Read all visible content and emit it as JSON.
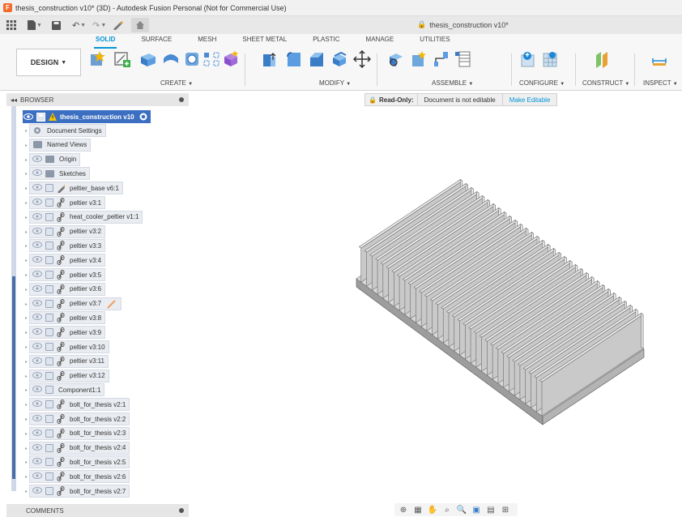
{
  "window": {
    "title": "thesis_construction v10* (3D) - Autodesk Fusion Personal (Not for Commercial Use)",
    "app_icon": "F"
  },
  "quick_access": {
    "document_title": "thesis_construction v10*"
  },
  "ribbon": {
    "workspace_label": "DESIGN",
    "tabs": [
      "SOLID",
      "SURFACE",
      "MESH",
      "SHEET METAL",
      "PLASTIC",
      "MANAGE",
      "UTILITIES"
    ],
    "active_tab": "SOLID",
    "groups": {
      "create": "CREATE",
      "modify": "MODIFY",
      "assemble": "ASSEMBLE",
      "configure": "CONFIGURE",
      "construct": "CONSTRUCT",
      "inspect": "INSPECT"
    }
  },
  "browser": {
    "header": "BROWSER",
    "root_label": "thesis_construction v10",
    "items": [
      {
        "label": "Document Settings",
        "kind": "settings"
      },
      {
        "label": "Named Views",
        "kind": "folder"
      },
      {
        "label": "Origin",
        "kind": "folder"
      },
      {
        "label": "Sketches",
        "kind": "folder"
      },
      {
        "label": "peltier_base v6:1",
        "kind": "component"
      },
      {
        "label": "peltier v3:1",
        "kind": "link"
      },
      {
        "label": "heat_cooler_peltier v1:1",
        "kind": "link"
      },
      {
        "label": "peltier v3:2",
        "kind": "link"
      },
      {
        "label": "peltier v3:3",
        "kind": "link"
      },
      {
        "label": "peltier v3:4",
        "kind": "link"
      },
      {
        "label": "peltier v3:5",
        "kind": "link"
      },
      {
        "label": "peltier v3:6",
        "kind": "link"
      },
      {
        "label": "peltier v3:7",
        "kind": "link"
      },
      {
        "label": "peltier v3:8",
        "kind": "link"
      },
      {
        "label": "peltier v3:9",
        "kind": "link"
      },
      {
        "label": "peltier v3:10",
        "kind": "link"
      },
      {
        "label": "peltier v3:11",
        "kind": "link"
      },
      {
        "label": "peltier v3:12",
        "kind": "link"
      },
      {
        "label": "Component1:1",
        "kind": "plain"
      },
      {
        "label": "bolt_for_thesis v2:1",
        "kind": "link"
      },
      {
        "label": "bolt_for_thesis v2:2",
        "kind": "link"
      },
      {
        "label": "bolt_for_thesis v2:3",
        "kind": "link"
      },
      {
        "label": "bolt_for_thesis v2:4",
        "kind": "link"
      },
      {
        "label": "bolt_for_thesis v2:5",
        "kind": "link"
      },
      {
        "label": "bolt_for_thesis v2:6",
        "kind": "link"
      },
      {
        "label": "bolt_for_thesis v2:7",
        "kind": "link"
      }
    ]
  },
  "banner": {
    "label": "Read-Only:",
    "message": "Document is not editable",
    "action": "Make Editable"
  },
  "comments": {
    "label": "COMMENTS"
  },
  "colors": {
    "accent": "#0696d7",
    "browser_selection": "#3c6fc1",
    "model_face": "#c9c9c9"
  }
}
